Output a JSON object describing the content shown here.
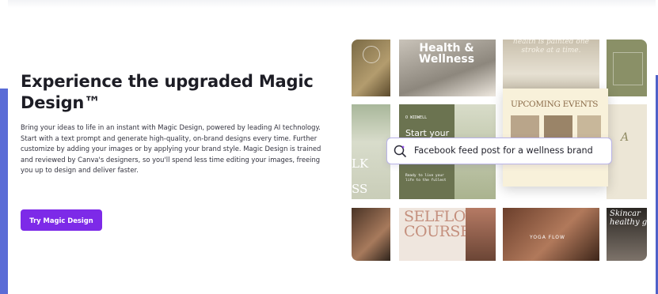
{
  "hero": {
    "title": "Experience the upgraded Magic Design™",
    "description": "Bring your ideas to life in an instant with Magic Design, powered by leading AI technology. Start with a text prompt and generate high-quality, on-brand designs every time. Further customize by adding your images or by applying your brand style. Magic Design is trained and reviewed by Canva's designers, so you'll spend less time editing your images, freeing you up to design and deliver faster.",
    "cta_label": "Try Magic Design",
    "cta_color": "#7d2ae8"
  },
  "gallery": {
    "tiles": {
      "health_title": "Health & Wellness",
      "stroke_text": "health is painted one stroke at a time.",
      "upcoming_events": "UPCOMING EVENTS",
      "start_your": "Start your",
      "k_text": "LK",
      "ss_text": "SS",
      "selflove": "SELFLOVE COURSE",
      "yoga_flow": "YOGA FLOW",
      "skincare": "Skincar healthy g",
      "small_caption": "Ready to live your life to the fullest",
      "brand_tag": "O WIDWELL"
    }
  },
  "prompt": {
    "icon": "magic-search-icon",
    "text": "Facebook feed post for a wellness brand"
  }
}
